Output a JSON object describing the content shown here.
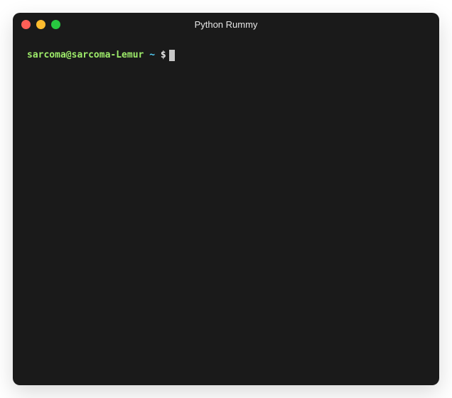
{
  "window": {
    "title": "Python Rummy"
  },
  "prompt": {
    "user_host": "sarcoma@sarcoma-Lemur",
    "separator1": " ",
    "path": "~",
    "separator2": " ",
    "symbol": "$"
  }
}
